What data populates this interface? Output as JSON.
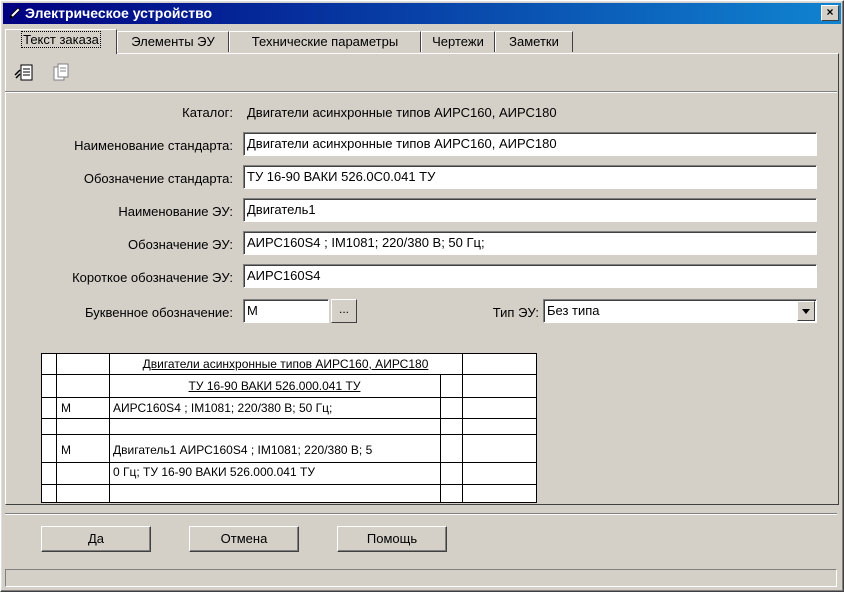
{
  "window": {
    "title": "Электрическое устройство",
    "close_glyph": "×"
  },
  "tabs": [
    {
      "label": "Текст заказа"
    },
    {
      "label": "Элементы ЭУ"
    },
    {
      "label": "Технические параметры"
    },
    {
      "label": "Чертежи"
    },
    {
      "label": "Заметки"
    }
  ],
  "form": {
    "catalog_label": "Каталог:",
    "catalog_value": "Двигатели асинхронные типов АИРС160, АИРС180",
    "std_name_label": "Наименование стандарта:",
    "std_name_value": "Двигатели асинхронные типов АИРС160, АИРС180",
    "std_code_label": "Обозначение стандарта:",
    "std_code_value": "ТУ 16-90 ВАКИ 526.0С0.041 ТУ",
    "eu_name_label": "Наименование ЭУ:",
    "eu_name_value": "Двигатель1",
    "eu_code_label": "Обозначение ЭУ:",
    "eu_code_value": "АИРС160S4 ; IM1081; 220/380 В; 50 Гц;",
    "eu_short_label": "Короткое обозначение ЭУ:",
    "eu_short_value": "АИРС160S4",
    "letter_label": "Буквенное обозначение:",
    "letter_value": "М",
    "browse_label": "...",
    "type_label": "Тип ЭУ:",
    "type_value": "Без типа"
  },
  "preview": {
    "header1": "Двигатели асинхронные типов АИРС160, АИРС180",
    "header2": "ТУ 16-90 ВАКИ 526.000.041 ТУ",
    "row1_code": "М",
    "row1_text": "АИРС160S4 ; IM1081; 220/380 В; 50 Гц;",
    "row2_code": "М",
    "row2_text1": "Двигатель1 АИРС160S4 ; IM1081; 220/380 В; 5",
    "row2_text2": "0 Гц; ТУ 16-90 ВАКИ 526.000.041 ТУ"
  },
  "buttons": {
    "ok": "Да",
    "cancel": "Отмена",
    "help": "Помощь"
  },
  "colors": {
    "face": "#d4d0c8",
    "title_start": "#000080",
    "title_end": "#1084d0"
  },
  "icons": {
    "title": "pencil-icon",
    "toolbar1": "paste-text-icon",
    "toolbar2": "copy-doc-icon"
  }
}
